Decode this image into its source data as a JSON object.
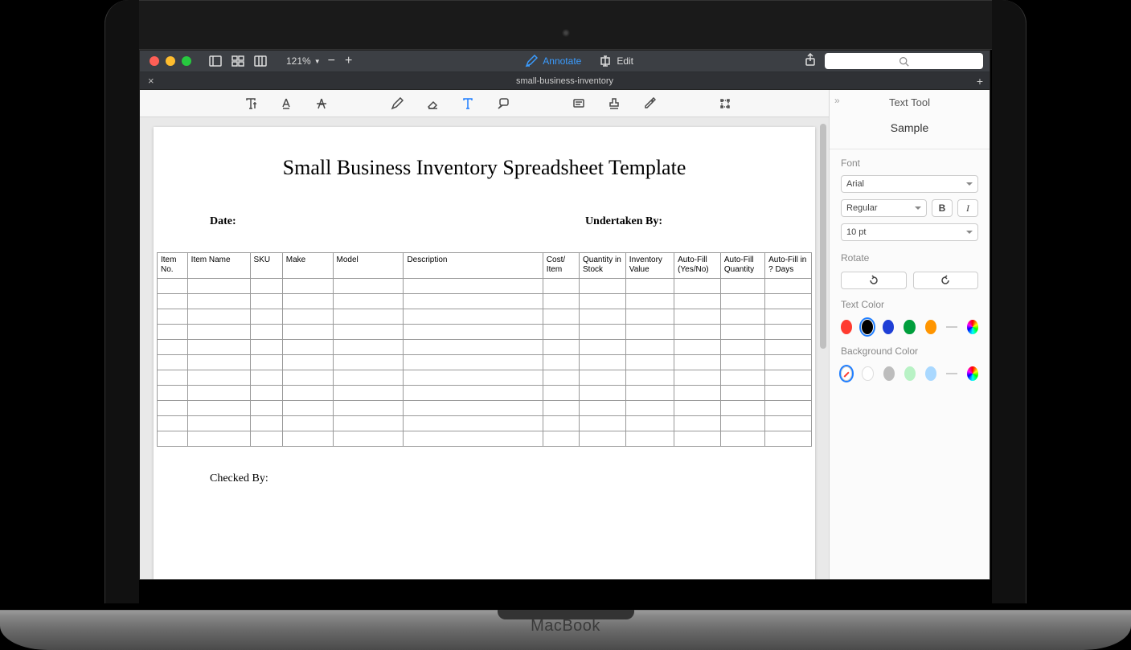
{
  "toolbar": {
    "zoom_label": "121%",
    "annotate_label": "Annotate",
    "edit_label": "Edit"
  },
  "tab": {
    "title": "small-business-inventory"
  },
  "document": {
    "title": "Small Business Inventory Spreadsheet Template",
    "date_label": "Date:",
    "undertaken_label": "Undertaken By:",
    "checked_by_label": "Checked By:",
    "table_headers": [
      "Item No.",
      "Item Name",
      "SKU",
      "Make",
      "Model",
      "Description",
      "Cost/ Item",
      "Quantity in Stock",
      "Inventory Value",
      "Auto-Fill (Yes/No)",
      "Auto-Fill Quantity",
      "Auto-Fill in ? Days"
    ],
    "table_rows": [
      [
        "",
        "",
        "",
        "",
        "",
        "",
        "",
        "",
        "",
        "",
        "",
        ""
      ],
      [
        "",
        "",
        "",
        "",
        "",
        "",
        "",
        "",
        "",
        "",
        "",
        ""
      ],
      [
        "",
        "",
        "",
        "",
        "",
        "",
        "",
        "",
        "",
        "",
        "",
        ""
      ],
      [
        "",
        "",
        "",
        "",
        "",
        "",
        "",
        "",
        "",
        "",
        "",
        ""
      ],
      [
        "",
        "",
        "",
        "",
        "",
        "",
        "",
        "",
        "",
        "",
        "",
        ""
      ],
      [
        "",
        "",
        "",
        "",
        "",
        "",
        "",
        "",
        "",
        "",
        "",
        ""
      ],
      [
        "",
        "",
        "",
        "",
        "",
        "",
        "",
        "",
        "",
        "",
        "",
        ""
      ],
      [
        "",
        "",
        "",
        "",
        "",
        "",
        "",
        "",
        "",
        "",
        "",
        ""
      ],
      [
        "",
        "",
        "",
        "",
        "",
        "",
        "",
        "",
        "",
        "",
        "",
        ""
      ],
      [
        "",
        "",
        "",
        "",
        "",
        "",
        "",
        "",
        "",
        "",
        "",
        ""
      ],
      [
        "",
        "",
        "",
        "",
        "",
        "",
        "",
        "",
        "",
        "",
        "",
        ""
      ]
    ]
  },
  "sidebar": {
    "title": "Text Tool",
    "sample": "Sample",
    "font_section": "Font",
    "font_family": "Arial",
    "font_weight": "Regular",
    "bold_label": "B",
    "italic_label": "I",
    "font_size": "10 pt",
    "rotate_section": "Rotate",
    "text_color_section": "Text Color",
    "bg_color_section": "Background Color",
    "text_colors": [
      "#ff3b30",
      "#000000",
      "#1f3fd6",
      "#009e3c",
      "#ff9500"
    ],
    "text_selected_index": 1,
    "bg_colors": [
      "none",
      "#ffffff",
      "#bdbdbd",
      "#b8f2c5",
      "#a9d8ff"
    ],
    "bg_selected_index": 0
  },
  "macbook_label": "MacBook"
}
